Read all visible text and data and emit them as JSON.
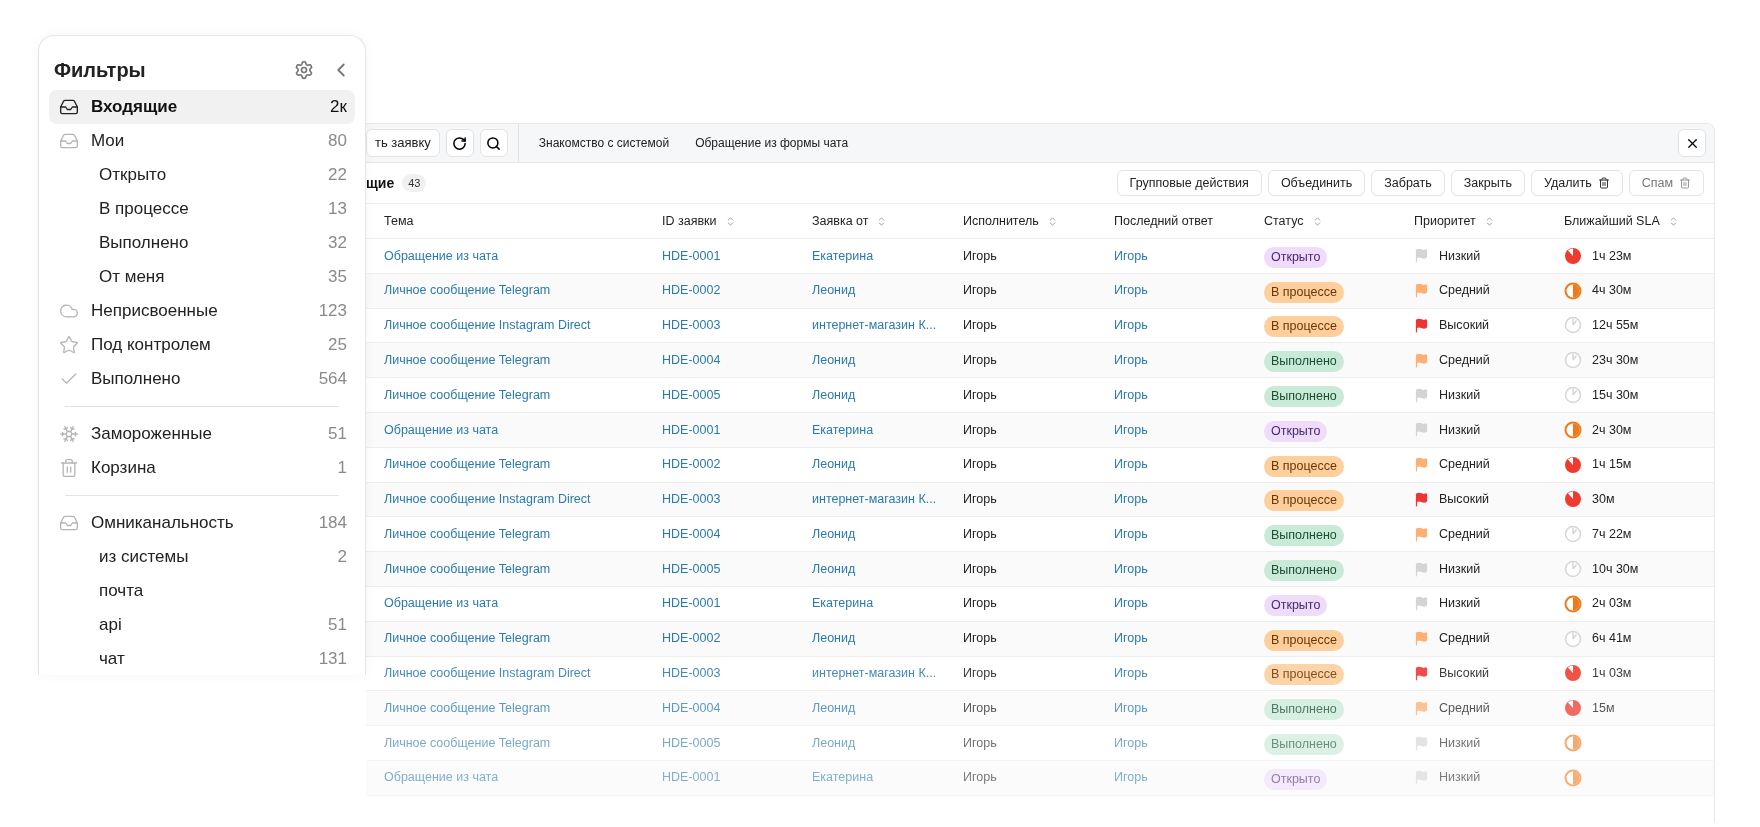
{
  "sidebar": {
    "title": "Фильтры",
    "groups": [
      {
        "items": [
          {
            "kind": "inbox",
            "label": "Входящие",
            "count": "2к",
            "selected": true
          },
          {
            "kind": "inbox",
            "label": "Мои",
            "count": "80",
            "selected": false,
            "children": [
              {
                "label": "Открыто",
                "count": "22",
                "selected": false
              },
              {
                "label": "В процессе",
                "count": "13",
                "selected": false
              },
              {
                "label": "Выполнено",
                "count": "32",
                "selected": false
              },
              {
                "label": "От меня",
                "count": "35",
                "selected": false
              }
            ]
          },
          {
            "kind": "cloud",
            "label": "Неприсвоенные",
            "count": "123",
            "selected": false
          },
          {
            "kind": "star",
            "label": "Под контролем",
            "count": "25",
            "selected": false
          },
          {
            "kind": "check",
            "label": "Выполнено",
            "count": "564",
            "selected": false
          }
        ]
      },
      {
        "items": [
          {
            "kind": "snowflake",
            "label": "Замороженные",
            "count": "51",
            "selected": false
          },
          {
            "kind": "trash",
            "label": "Корзина",
            "count": "1",
            "selected": false
          }
        ]
      },
      {
        "items": [
          {
            "kind": "inbox",
            "label": "Омниканальность",
            "count": "184",
            "selected": false,
            "children": [
              {
                "label": "из системы",
                "count": "2",
                "selected": false
              },
              {
                "label": "почта",
                "selected": false
              },
              {
                "label": "api",
                "count": "51",
                "selected": false
              },
              {
                "label": "чат",
                "count": "131",
                "selected": false
              }
            ]
          }
        ]
      }
    ]
  },
  "toolbar": {
    "create_button": "ть заявку",
    "tabs": [
      {
        "label": "Знакомство с системой",
        "selected": false
      },
      {
        "label": "Обращение из формы чата",
        "selected": false
      }
    ]
  },
  "list": {
    "title": "щие",
    "count": "43",
    "actions": [
      {
        "label": "Групповые действия",
        "kind": "plain",
        "disabled": false
      },
      {
        "label": "Объединить",
        "kind": "plain",
        "disabled": false
      },
      {
        "label": "Забрать",
        "kind": "plain",
        "disabled": false
      },
      {
        "label": "Закрыть",
        "kind": "plain",
        "disabled": false
      },
      {
        "label": "Удалить",
        "kind": "trash",
        "disabled": false
      },
      {
        "label": "Спам",
        "kind": "trash",
        "disabled": true
      }
    ]
  },
  "table": {
    "columns": [
      {
        "label": "Тема",
        "sortable": false
      },
      {
        "label": "ID заявки",
        "sortable": true
      },
      {
        "label": "Заявка от",
        "sortable": true
      },
      {
        "label": "Исполнитель",
        "sortable": true
      },
      {
        "label": "Последний ответ",
        "sortable": false
      },
      {
        "label": "Статус",
        "sortable": true
      },
      {
        "label": "Приоритет",
        "sortable": true
      },
      {
        "label": "Ближайший SLA",
        "sortable": true
      }
    ],
    "rows": [
      {
        "subject": "Обращение из чата",
        "id": "HDE-0001",
        "from": "Екатерина",
        "assignee": "Игорь",
        "last_reply": "Игорь",
        "status": {
          "label": "Открыто",
          "kind": "open"
        },
        "priority": {
          "label": "Низкий",
          "kind": "low"
        },
        "sla": {
          "time": "1ч 23м",
          "kind": "critical"
        }
      },
      {
        "subject": "Личное сообщение Telegram",
        "id": "HDE-0002",
        "from": "Леонид",
        "assignee": "Игорь",
        "last_reply": "Игорь",
        "status": {
          "label": "В процессе",
          "kind": "progress"
        },
        "priority": {
          "label": "Средний",
          "kind": "medium"
        },
        "sla": {
          "time": "4ч 30м",
          "kind": "warning"
        }
      },
      {
        "subject": "Личное сообщение Instagram Direct",
        "id": "HDE-0003",
        "from": "интернет-магазин К...",
        "assignee": "Игорь",
        "last_reply": "Игорь",
        "status": {
          "label": "В процессе",
          "kind": "progress"
        },
        "priority": {
          "label": "Высокий",
          "kind": "high"
        },
        "sla": {
          "time": "12ч 55м",
          "kind": "ok"
        }
      },
      {
        "subject": "Личное сообщение Telegram",
        "id": "HDE-0004",
        "from": "Леонид",
        "assignee": "Игорь",
        "last_reply": "Игорь",
        "status": {
          "label": "Выполнено",
          "kind": "done"
        },
        "priority": {
          "label": "Средний",
          "kind": "medium"
        },
        "sla": {
          "time": "23ч 30м",
          "kind": "ok"
        }
      },
      {
        "subject": "Личное сообщение Telegram",
        "id": "HDE-0005",
        "from": "Леонид",
        "assignee": "Игорь",
        "last_reply": "Игорь",
        "status": {
          "label": "Выполнено",
          "kind": "done"
        },
        "priority": {
          "label": "Низкий",
          "kind": "low"
        },
        "sla": {
          "time": "15ч 30м",
          "kind": "ok"
        }
      },
      {
        "subject": "Обращение из чата",
        "id": "HDE-0001",
        "from": "Екатерина",
        "assignee": "Игорь",
        "last_reply": "Игорь",
        "status": {
          "label": "Открыто",
          "kind": "open"
        },
        "priority": {
          "label": "Низкий",
          "kind": "low"
        },
        "sla": {
          "time": "2ч 30м",
          "kind": "warning"
        }
      },
      {
        "subject": "Личное сообщение Telegram",
        "id": "HDE-0002",
        "from": "Леонид",
        "assignee": "Игорь",
        "last_reply": "Игорь",
        "status": {
          "label": "В процессе",
          "kind": "progress"
        },
        "priority": {
          "label": "Средний",
          "kind": "medium"
        },
        "sla": {
          "time": "1ч 15м",
          "kind": "critical"
        }
      },
      {
        "subject": "Личное сообщение Instagram Direct",
        "id": "HDE-0003",
        "from": "интернет-магазин К...",
        "assignee": "Игорь",
        "last_reply": "Игорь",
        "status": {
          "label": "В процессе",
          "kind": "progress"
        },
        "priority": {
          "label": "Высокий",
          "kind": "high"
        },
        "sla": {
          "time": "30м",
          "kind": "critical"
        }
      },
      {
        "subject": "Личное сообщение Telegram",
        "id": "HDE-0004",
        "from": "Леонид",
        "assignee": "Игорь",
        "last_reply": "Игорь",
        "status": {
          "label": "Выполнено",
          "kind": "done"
        },
        "priority": {
          "label": "Средний",
          "kind": "medium"
        },
        "sla": {
          "time": "7ч 22м",
          "kind": "ok"
        }
      },
      {
        "subject": "Личное сообщение Telegram",
        "id": "HDE-0005",
        "from": "Леонид",
        "assignee": "Игорь",
        "last_reply": "Игорь",
        "status": {
          "label": "Выполнено",
          "kind": "done"
        },
        "priority": {
          "label": "Низкий",
          "kind": "low"
        },
        "sla": {
          "time": "10ч 30м",
          "kind": "ok"
        }
      },
      {
        "subject": "Обращение из чата",
        "id": "HDE-0001",
        "from": "Екатерина",
        "assignee": "Игорь",
        "last_reply": "Игорь",
        "status": {
          "label": "Открыто",
          "kind": "open"
        },
        "priority": {
          "label": "Низкий",
          "kind": "low"
        },
        "sla": {
          "time": "2ч 03м",
          "kind": "warning"
        }
      },
      {
        "subject": "Личное сообщение Telegram",
        "id": "HDE-0002",
        "from": "Леонид",
        "assignee": "Игорь",
        "last_reply": "Игорь",
        "status": {
          "label": "В процессе",
          "kind": "progress"
        },
        "priority": {
          "label": "Средний",
          "kind": "medium"
        },
        "sla": {
          "time": "6ч 41м",
          "kind": "ok"
        }
      },
      {
        "subject": "Личное сообщение Instagram Direct",
        "id": "HDE-0003",
        "from": "интернет-магазин К...",
        "assignee": "Игорь",
        "last_reply": "Игорь",
        "status": {
          "label": "В процессе",
          "kind": "progress"
        },
        "priority": {
          "label": "Высокий",
          "kind": "high"
        },
        "sla": {
          "time": "1ч 03м",
          "kind": "critical"
        }
      },
      {
        "subject": "Личное сообщение Telegram",
        "id": "HDE-0004",
        "from": "Леонид",
        "assignee": "Игорь",
        "last_reply": "Игорь",
        "status": {
          "label": "Выполнено",
          "kind": "done"
        },
        "priority": {
          "label": "Средний",
          "kind": "medium"
        },
        "sla": {
          "time": "15м",
          "kind": "critical"
        }
      },
      {
        "subject": "Личное сообщение Telegram",
        "id": "HDE-0005",
        "from": "Леонид",
        "assignee": "Игорь",
        "last_reply": "Игорь",
        "status": {
          "label": "Выполнено",
          "kind": "done"
        },
        "priority": {
          "label": "Низкий",
          "kind": "low"
        },
        "sla": {
          "kind": "warning"
        }
      },
      {
        "subject": "Обращение из чата",
        "id": "HDE-0001",
        "from": "Екатерина",
        "assignee": "Игорь",
        "last_reply": "Игорь",
        "status": {
          "label": "Открыто",
          "kind": "open"
        },
        "priority": {
          "label": "Низкий",
          "kind": "low"
        },
        "sla": {
          "kind": "warning"
        }
      }
    ]
  }
}
